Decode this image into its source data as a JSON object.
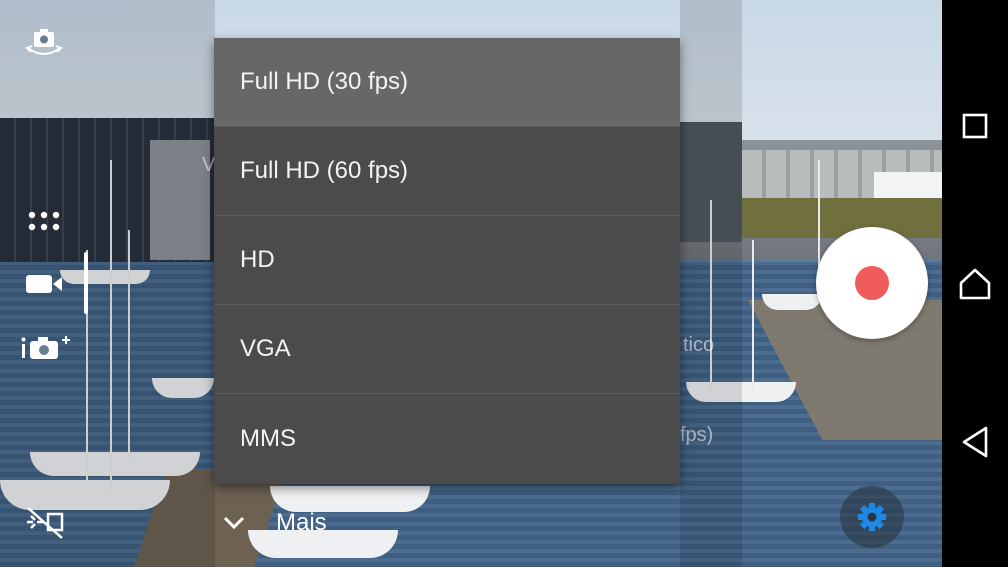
{
  "resolution_menu": {
    "options": [
      {
        "label": "Full HD (30 fps)",
        "selected": true
      },
      {
        "label": "Full HD (60 fps)",
        "selected": false
      },
      {
        "label": "HD",
        "selected": false
      },
      {
        "label": "VGA",
        "selected": false
      },
      {
        "label": "MMS",
        "selected": false
      }
    ]
  },
  "background_labels": {
    "left_fragment": "V",
    "right_fragment_1": "tico",
    "right_fragment_2": "fps)"
  },
  "more": {
    "label": "Mais",
    "icon": "chevron-down-icon"
  },
  "camera_controls": {
    "switch_camera_icon": "switch-camera-icon",
    "grid_icon": "grid-dots-icon",
    "video_mode_icon": "video-camera-icon",
    "photo_mode_icon": "photo-plus-icon",
    "flash_icon": "flash-off-icon"
  },
  "record_button": {
    "icon": "record-icon",
    "color": "#f05b5b"
  },
  "settings_button": {
    "icon": "gear-icon",
    "color": "#1e88e5"
  },
  "navigation": {
    "recent": "recent-apps-icon",
    "home": "home-icon",
    "back": "back-icon"
  }
}
